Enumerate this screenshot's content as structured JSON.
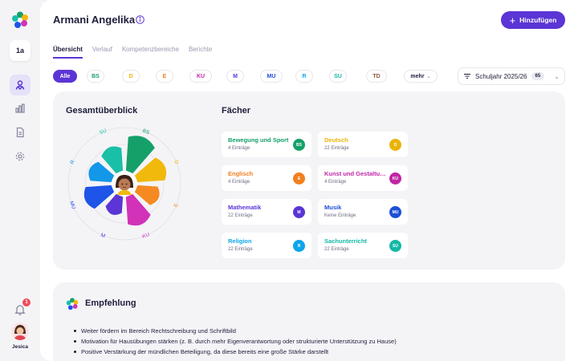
{
  "sidebar": {
    "class_label": "1a",
    "notification_count": "1",
    "user_name": "Jesica"
  },
  "header": {
    "student_name": "Armani Angelika",
    "add_button_label": "Hinzufügen"
  },
  "tabs": [
    {
      "label": "Übersicht",
      "active": true
    },
    {
      "label": "Verlauf",
      "active": false
    },
    {
      "label": "Kompetenzbereiche",
      "active": false
    },
    {
      "label": "Berichte",
      "active": false
    }
  ],
  "filters": {
    "items": [
      {
        "label": "Alle",
        "color": "#5b35d5",
        "active": true
      },
      {
        "label": "BS",
        "color": "#15a06a"
      },
      {
        "label": "D",
        "color": "#eab308"
      },
      {
        "label": "E",
        "color": "#f0801f"
      },
      {
        "label": "KU",
        "color": "#c026a6"
      },
      {
        "label": "M",
        "color": "#5b35d5"
      },
      {
        "label": "MU",
        "color": "#1d4ed8"
      },
      {
        "label": "R",
        "color": "#0ea5e9"
      },
      {
        "label": "SU",
        "color": "#14b8a6"
      },
      {
        "label": "TD",
        "color": "#8b5a3c"
      }
    ],
    "more_label": "mehr",
    "school_year_label": "Schuljahr 2025/26",
    "school_year_count": "65"
  },
  "overview": {
    "title": "Gesamtüberblick",
    "subjects_title": "Fächer",
    "petals": [
      {
        "code": "BS",
        "color": "#15a06a"
      },
      {
        "code": "D",
        "color": "#f0b90b"
      },
      {
        "code": "E",
        "color": "#f58a23"
      },
      {
        "code": "KU",
        "color": "#d132b8"
      },
      {
        "code": "M",
        "color": "#5b35d5"
      },
      {
        "code": "MU",
        "color": "#1e55e8"
      },
      {
        "code": "R",
        "color": "#1397e8"
      },
      {
        "code": "SU",
        "color": "#19bfa6"
      }
    ]
  },
  "subjects": [
    {
      "name": "Bewegung und Sport",
      "count": "4 Einträge",
      "code": "BS",
      "color": "#15a06a"
    },
    {
      "name": "Deutsch",
      "count": "22 Einträge",
      "code": "D",
      "color": "#eab308"
    },
    {
      "name": "Englisch",
      "count": "4 Einträge",
      "code": "E",
      "color": "#f0801f"
    },
    {
      "name": "Kunst und Gestaltung",
      "count": "4 Einträge",
      "code": "KU",
      "color": "#c026a6"
    },
    {
      "name": "Mathematik",
      "count": "22 Einträge",
      "code": "M",
      "color": "#5b35d5"
    },
    {
      "name": "Musik",
      "count": "Keine Einträge",
      "code": "MU",
      "color": "#1d4ed8"
    },
    {
      "name": "Religion",
      "count": "22 Einträge",
      "code": "R",
      "color": "#0ea5e9"
    },
    {
      "name": "Sachunterricht",
      "count": "22 Einträge",
      "code": "SU",
      "color": "#14b8a6"
    }
  ],
  "recommendation": {
    "title": "Empfehlung",
    "items": [
      "Weiter fördern im Bereich Rechtschreibung und Schriftbild",
      "Motivation für Hausübungen stärken (z. B. durch mehr Eigenverantwortung oder strukturierte Unterstützung zu Hause)",
      "Positive Verstärkung der mündlichen Beteiligung, da diese bereits eine große Stärke darstellt"
    ]
  }
}
